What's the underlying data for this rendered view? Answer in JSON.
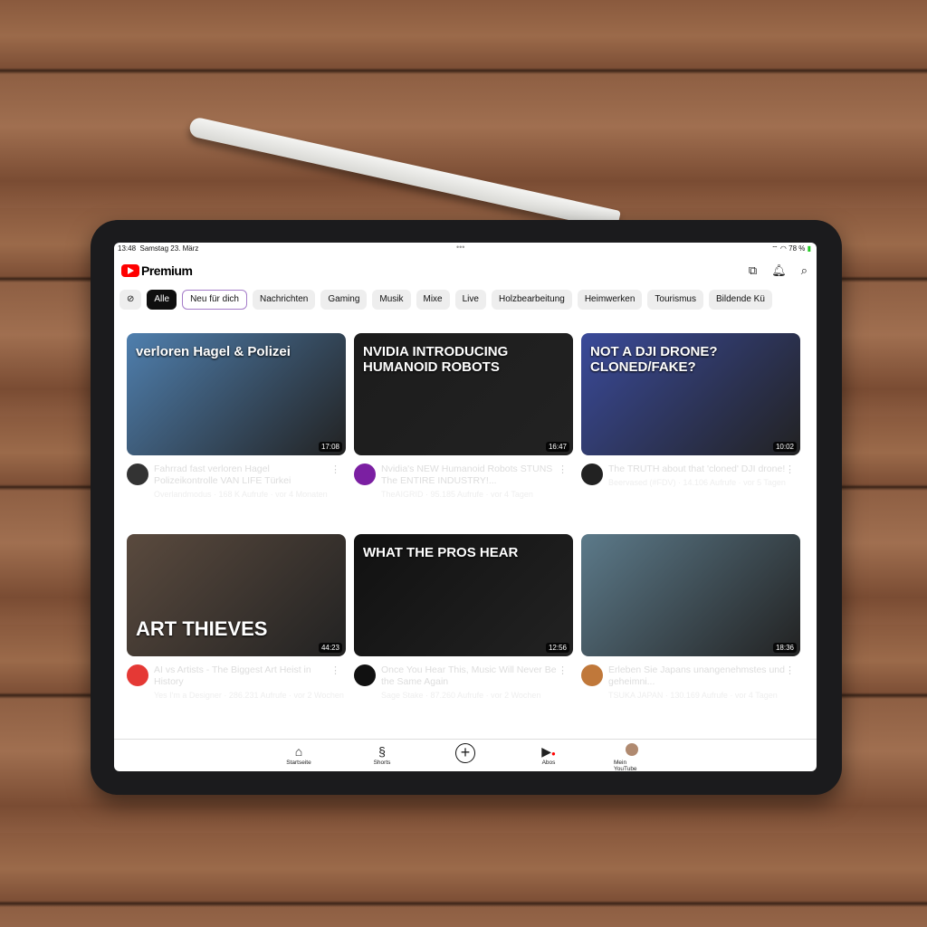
{
  "status": {
    "time": "13:48",
    "date": "Samstag 23. März",
    "battery": "78 %"
  },
  "header": {
    "brand": "Premium",
    "icons": [
      "cast-icon",
      "bell-icon",
      "search-icon"
    ]
  },
  "chips": [
    "Alle",
    "Neu für dich",
    "Nachrichten",
    "Gaming",
    "Musik",
    "Mixe",
    "Live",
    "Holzbearbeitung",
    "Heimwerken",
    "Tourismus",
    "Bildende Kü"
  ],
  "videos": [
    {
      "title": "Fahrrad fast verloren Hagel Polizeikontrolle VAN LIFE Türkei",
      "meta": "Overlandmodus · 168 K Aufrufe · vor 4 Monaten",
      "duration": "17:08",
      "thumb_text": "verloren Hagel & Polizei",
      "bg": "#4f7fae",
      "avatar": "#333"
    },
    {
      "title": "Nvidia's NEW Humanoid Robots STUNS The ENTIRE INDUSTRY!...",
      "meta": "TheAIGRID · 95.185 Aufrufe · vor 4 Tagen",
      "duration": "16:47",
      "thumb_text": "NVIDIA INTRODUCING HUMANOID ROBOTS",
      "bg": "#1c1c1c",
      "avatar": "#7b1fa2"
    },
    {
      "title": "The TRUTH about that 'cloned' DJI drone!",
      "meta": "Beervased (#FDV) · 14.106 Aufrufe · vor 5 Tagen",
      "duration": "10:02",
      "thumb_text": "NOT A DJI DRONE? CLONED/FAKE?",
      "bg": "#3a4a9a",
      "avatar": "#222"
    },
    {
      "title": "AI vs Artists - The Biggest Art Heist in History",
      "meta": "Yes I'm a Designer · 286.231 Aufrufe · vor 2 Wochen",
      "duration": "44:23",
      "thumb_text": "ART THIEVES",
      "bg": "#5a4a3e",
      "avatar": "#e53935"
    },
    {
      "title": "Once You Hear This, Music Will Never Be the Same Again",
      "meta": "Sage Stake · 87.260 Aufrufe · vor 2 Wochen",
      "duration": "12:56",
      "thumb_text": "WHAT THE PROS HEAR",
      "bg": "#111",
      "avatar": "#111"
    },
    {
      "title": "Erleben Sie Japans unangenehmstes und geheimni...",
      "meta": "TSUKA JAPAN · 130.169 Aufrufe · vor 4 Tagen",
      "duration": "18:36",
      "thumb_text": "",
      "bg": "#5c7a8a",
      "avatar": "#c0783a"
    }
  ],
  "bottom_nav": [
    {
      "label": "Startseite",
      "icon": "home-icon"
    },
    {
      "label": "Shorts",
      "icon": "shorts-icon"
    },
    {
      "label": "",
      "icon": "create-plus-icon"
    },
    {
      "label": "Abos",
      "icon": "subscriptions-icon"
    },
    {
      "label": "Mein YouTube",
      "icon": "avatar-icon"
    }
  ],
  "colors": {
    "brand": "#ff0000",
    "chip_active": "#0f0f0f"
  }
}
